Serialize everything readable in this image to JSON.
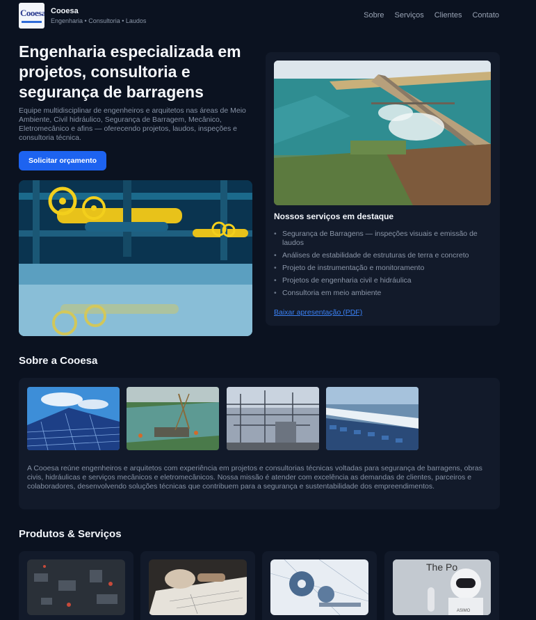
{
  "header": {
    "logo_text": "Cooesa",
    "brand_name": "Cooesa",
    "tagline": "Engenharia • Consultoria • Laudos",
    "nav": [
      "Sobre",
      "Serviços",
      "Clientes",
      "Contato"
    ]
  },
  "hero": {
    "title": "Engenharia especializada em projetos, consultoria e segurança de barragens",
    "description": "Equipe multidisciplinar de engenheiros e arquitetos nas áreas de Meio Ambiente, Civil hidráulico, Segurança de Barragem, Mecânico, Eletromecânico e afins — oferecendo projetos, laudos, inspeções e consultoria técnica.",
    "cta_label": "Solicitar orçamento"
  },
  "featured": {
    "title": "Nossos serviços em destaque",
    "items": [
      "Segurança de Barragens — inspeções visuais e emissão de laudos",
      "Análises de estabilidade de estruturas de terra e concreto",
      "Projeto de instrumentação e monitoramento",
      "Projetos de engenharia civil e hidráulica",
      "Consultoria em meio ambiente"
    ],
    "link_label": "Baixar apresentação (PDF)"
  },
  "about": {
    "title": "Sobre a Cooesa",
    "text": "A Cooesa reúne engenheiros e arquitetos com experiência em projetos e consultorias técnicas voltadas para segurança de barragens, obras civis, hidráulicas e serviços mecânicos e eletromecânicos. Nossa missão é atender com excelência as demandas de clientes, parceiros e colaboradores, desenvolvendo soluções técnicas que contribuem para a segurança e sustentabilidade dos empreendimentos."
  },
  "products": {
    "title": "Produtos & Serviços",
    "robot_sign_text": "The Po",
    "robot_badge": "ASIMO"
  },
  "colors": {
    "background": "#0b1220",
    "card": "#121a2a",
    "accent": "#1d63f0",
    "link": "#3b82f6"
  }
}
